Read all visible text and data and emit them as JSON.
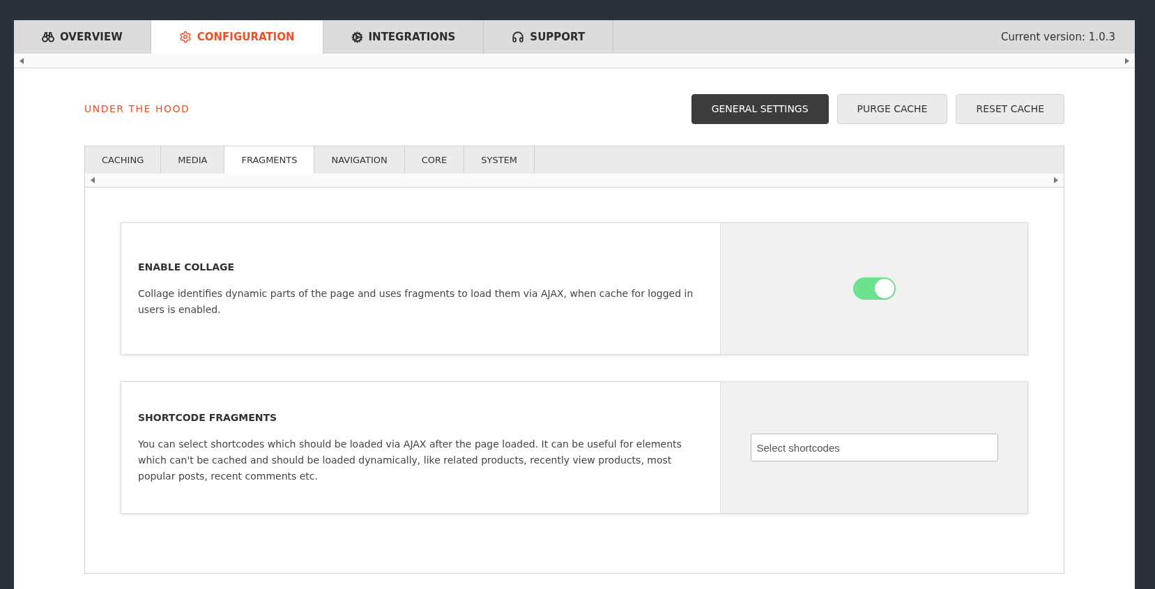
{
  "main_tabs": [
    {
      "label": "OVERVIEW",
      "kind": "binoculars",
      "selected": false
    },
    {
      "label": "CONFIGURATION",
      "kind": "gear",
      "selected": true
    },
    {
      "label": "INTEGRATIONS",
      "kind": "gears",
      "selected": false
    },
    {
      "label": "SUPPORT",
      "kind": "headset",
      "selected": false
    }
  ],
  "version": "Current version: 1.0.3",
  "section_title": "UNDER THE HOOD",
  "actions": [
    {
      "label": "GENERAL SETTINGS",
      "selected": true
    },
    {
      "label": "PURGE CACHE",
      "selected": false
    },
    {
      "label": "RESET CACHE",
      "selected": false
    }
  ],
  "sub_tabs": [
    {
      "label": "CACHING",
      "selected": false
    },
    {
      "label": "MEDIA",
      "selected": false
    },
    {
      "label": "FRAGMENTS",
      "selected": true
    },
    {
      "label": "NAVIGATION",
      "selected": false
    },
    {
      "label": "CORE",
      "selected": false
    },
    {
      "label": "SYSTEM",
      "selected": false
    }
  ],
  "settings": [
    {
      "kind": "toggle",
      "title": "ENABLE COLLAGE",
      "description": "Collage identifies dynamic parts of the page and uses fragments to load them via AJAX, when cache for logged in users is enabled.",
      "on": true
    },
    {
      "kind": "select",
      "title": "SHORTCODE FRAGMENTS",
      "description": "You can select shortcodes which should be loaded via AJAX after the page loaded. It can be useful for elements which can't be cached and should be loaded dynamically, like related products, recently view products, most popular posts, recent comments etc.",
      "placeholder": "Select shortcodes"
    }
  ]
}
